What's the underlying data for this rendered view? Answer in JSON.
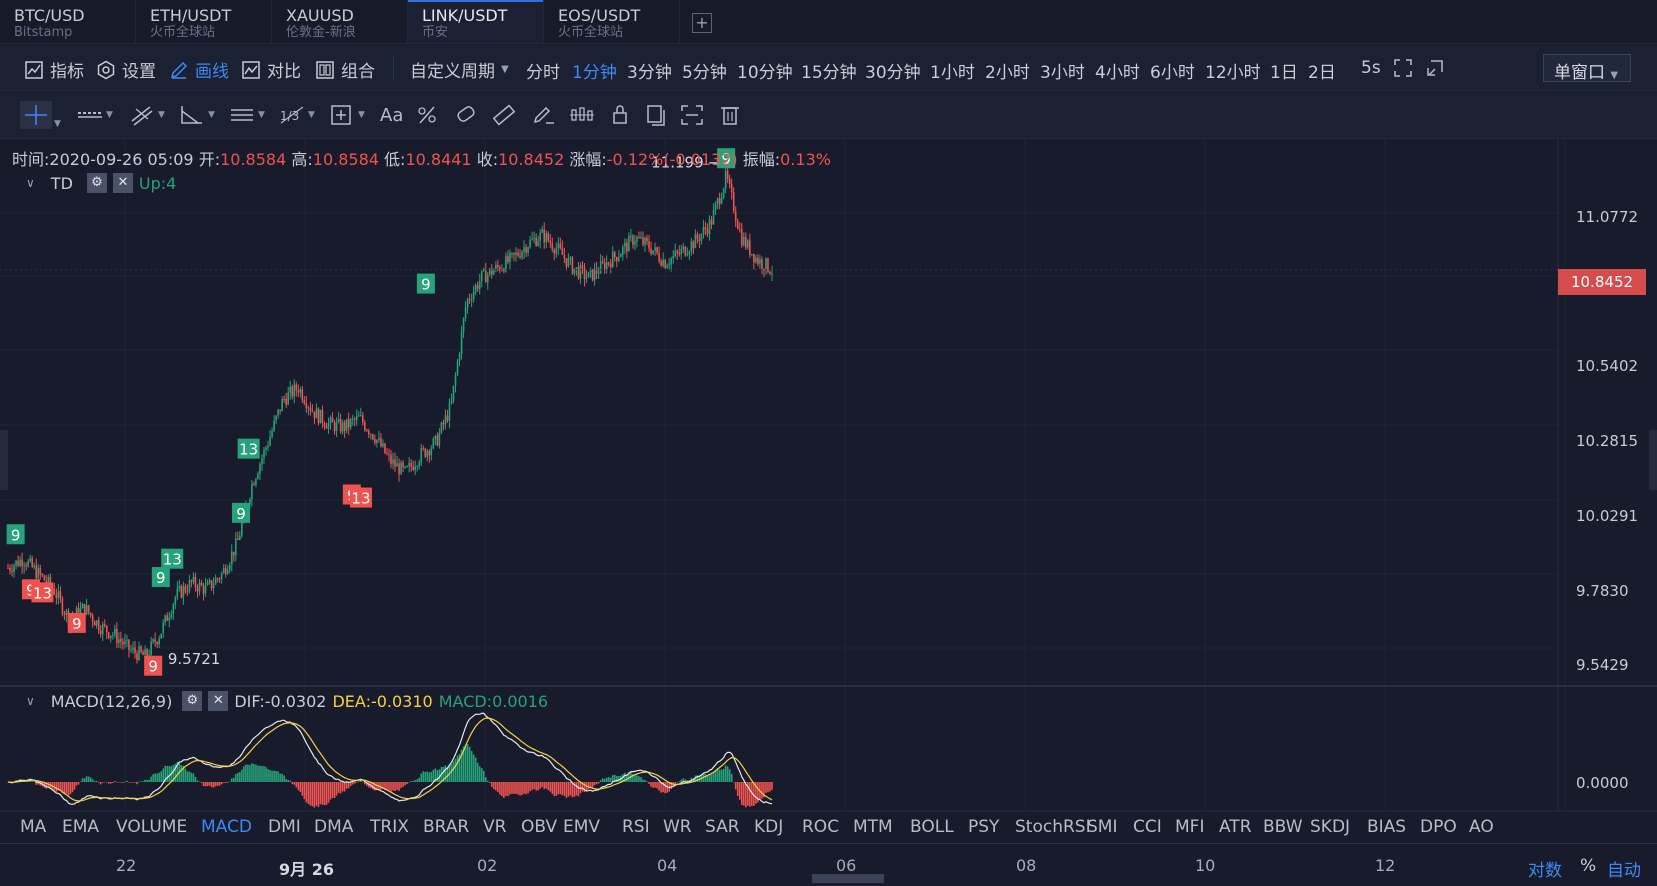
{
  "tabs": [
    {
      "symbol": "BTC/USD",
      "exchange": "Bitstamp"
    },
    {
      "symbol": "ETH/USDT",
      "exchange": "火币全球站"
    },
    {
      "symbol": "XAUUSD",
      "exchange": "伦敦金-新浪"
    },
    {
      "symbol": "LINK/USDT",
      "exchange": "币安"
    },
    {
      "symbol": "EOS/USDT",
      "exchange": "火币全球站"
    }
  ],
  "tab_add": "+",
  "toolbar": {
    "indicators": "指标",
    "settings": "设置",
    "draw": "画线",
    "compare": "对比",
    "combine": "组合",
    "custom_period": "自定义周期",
    "periods": [
      "分时",
      "1分钟",
      "3分钟",
      "5分钟",
      "10分钟",
      "15分钟",
      "30分钟",
      "1小时",
      "2小时",
      "3小时",
      "4小时",
      "6小时",
      "12小时",
      "1日",
      "2日"
    ],
    "active_period": "1分钟",
    "refresh": "5s",
    "window_mode": "单窗口"
  },
  "draw_tools": [
    "crosshair",
    "horizontal-line",
    "trend-line",
    "angle",
    "parallel-channel",
    "fibonacci",
    "rectangle",
    "text",
    "brush",
    "eraser",
    "ruler",
    "pencil",
    "pattern",
    "lock",
    "copy",
    "screenshot",
    "delete"
  ],
  "text_tool_label": "Aa",
  "ohlc": {
    "time_label": "时间:",
    "time": "2020-09-26 05:09",
    "open_label": "开:",
    "open": "10.8584",
    "high_label": "高:",
    "high": "10.8584",
    "low_label": "低:",
    "low": "10.8441",
    "close_label": "收:",
    "close": "10.8452",
    "change_label": "涨幅:",
    "change": "-0.12%(-0.0132)",
    "amp_label": "振幅:",
    "amp": "0.13%"
  },
  "td": {
    "name": "TD",
    "up_label": "Up:4"
  },
  "macd": {
    "name": "MACD(12,26,9)",
    "dif": "DIF:-0.0302",
    "dea": "DEA:-0.0310",
    "macd": "MACD:0.0016",
    "zero_label": "0.0000"
  },
  "price_axis": [
    "11.0772",
    "10.5402",
    "10.2815",
    "10.0291",
    "9.7830",
    "9.5429"
  ],
  "last_price": "10.8452",
  "annotations": {
    "high": "11.199",
    "low": "9.5721"
  },
  "td_markers": [
    {
      "label": "9",
      "color": "green"
    },
    {
      "label": "9",
      "color": "red"
    },
    {
      "label": "13",
      "color": "red"
    },
    {
      "label": "9",
      "color": "red"
    },
    {
      "label": "9",
      "color": "green"
    },
    {
      "label": "13",
      "color": "green"
    },
    {
      "label": "9",
      "color": "red"
    },
    {
      "label": "9",
      "color": "green"
    },
    {
      "label": "13",
      "color": "green"
    },
    {
      "label": "9",
      "color": "red"
    },
    {
      "label": "13",
      "color": "red"
    },
    {
      "label": "9",
      "color": "green"
    },
    {
      "label": "9",
      "color": "green"
    }
  ],
  "indicators": [
    "MA",
    "EMA",
    "VOLUME",
    "MACD",
    "DMI",
    "DMA",
    "TRIX",
    "BRAR",
    "VR",
    "OBV",
    "EMV",
    "RSI",
    "WR",
    "SAR",
    "KDJ",
    "ROC",
    "MTM",
    "BOLL",
    "PSY",
    "StochRSI",
    "SMI",
    "CCI",
    "MFI",
    "ATR",
    "BBW",
    "SKDJ",
    "BIAS",
    "DPO",
    "AO"
  ],
  "active_indicator": "MACD",
  "time_axis": [
    "22",
    "9月 26",
    "02",
    "04",
    "06",
    "08",
    "10",
    "12"
  ],
  "axis_options": {
    "log": "对数",
    "percent": "%",
    "auto": "自动"
  },
  "colors": {
    "up": "#26a37a",
    "down": "#ef5350",
    "accent": "#3d8af7",
    "dea": "#f5d142",
    "dif": "#e8e8e8",
    "bg": "#171b2b"
  },
  "chart_data": {
    "type": "candlestick",
    "price_range": [
      9.5,
      11.25
    ],
    "close_path": [
      [
        0,
        9.87
      ],
      [
        0.02,
        9.9
      ],
      [
        0.04,
        9.85
      ],
      [
        0.06,
        9.8
      ],
      [
        0.08,
        9.7
      ],
      [
        0.1,
        9.74
      ],
      [
        0.12,
        9.68
      ],
      [
        0.14,
        9.65
      ],
      [
        0.16,
        9.6
      ],
      [
        0.18,
        9.58
      ],
      [
        0.2,
        9.66
      ],
      [
        0.22,
        9.78
      ],
      [
        0.24,
        9.82
      ],
      [
        0.26,
        9.8
      ],
      [
        0.28,
        9.85
      ],
      [
        0.3,
        9.95
      ],
      [
        0.32,
        10.15
      ],
      [
        0.34,
        10.28
      ],
      [
        0.36,
        10.42
      ],
      [
        0.38,
        10.46
      ],
      [
        0.4,
        10.38
      ],
      [
        0.42,
        10.34
      ],
      [
        0.44,
        10.33
      ],
      [
        0.46,
        10.36
      ],
      [
        0.48,
        10.3
      ],
      [
        0.5,
        10.22
      ],
      [
        0.52,
        10.18
      ],
      [
        0.54,
        10.24
      ],
      [
        0.56,
        10.28
      ],
      [
        0.58,
        10.4
      ],
      [
        0.6,
        10.74
      ],
      [
        0.62,
        10.82
      ],
      [
        0.64,
        10.85
      ],
      [
        0.66,
        10.88
      ],
      [
        0.68,
        10.93
      ],
      [
        0.7,
        10.96
      ],
      [
        0.72,
        10.91
      ],
      [
        0.74,
        10.85
      ],
      [
        0.76,
        10.82
      ],
      [
        0.78,
        10.86
      ],
      [
        0.8,
        10.9
      ],
      [
        0.82,
        10.95
      ],
      [
        0.84,
        10.92
      ],
      [
        0.86,
        10.87
      ],
      [
        0.88,
        10.9
      ],
      [
        0.9,
        10.94
      ],
      [
        0.92,
        11.0
      ],
      [
        0.94,
        11.15
      ],
      [
        0.96,
        10.95
      ],
      [
        0.98,
        10.88
      ],
      [
        1.0,
        10.8452
      ]
    ]
  }
}
